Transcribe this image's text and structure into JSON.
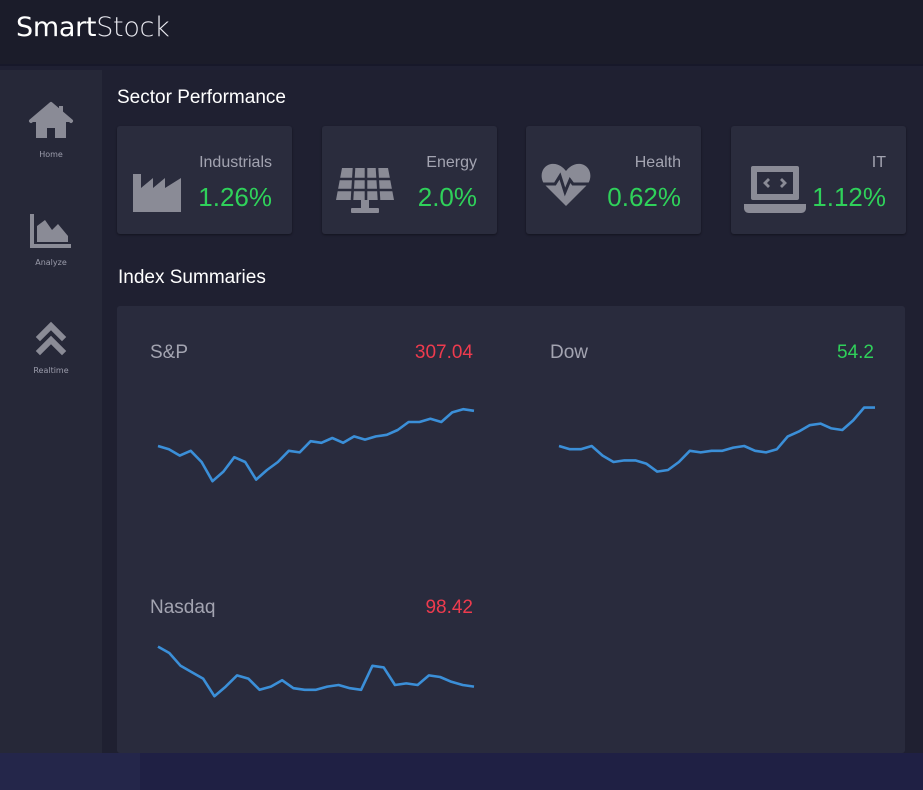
{
  "app": {
    "brand_strong": "Smart",
    "brand_light": "Stock"
  },
  "sidebar": {
    "items": [
      {
        "label": "Home",
        "icon": "home-icon"
      },
      {
        "label": "Analyze",
        "icon": "area-chart-icon"
      },
      {
        "label": "Realtime",
        "icon": "double-chevron-up-icon"
      }
    ]
  },
  "sectors": {
    "title": "Sector Performance",
    "items": [
      {
        "name": "Industrials",
        "value": "1.26%",
        "icon": "factory-icon"
      },
      {
        "name": "Energy",
        "value": "2.0%",
        "icon": "solar-panel-icon"
      },
      {
        "name": "Health",
        "value": "0.62%",
        "icon": "heartbeat-icon"
      },
      {
        "name": "IT",
        "value": "1.12%",
        "icon": "laptop-code-icon"
      }
    ]
  },
  "indexes": {
    "title": "Index Summaries",
    "items": [
      {
        "name": "S&P",
        "value": "307.04",
        "trend": "negative"
      },
      {
        "name": "Dow",
        "value": "54.2",
        "trend": "positive"
      },
      {
        "name": "Nasdaq",
        "value": "98.42",
        "trend": "negative"
      }
    ]
  },
  "colors": {
    "positive": "#2fd15a",
    "negative": "#ee3b4e",
    "line": "#3b8fd8",
    "icon": "#8a8b96"
  },
  "chart_data": [
    {
      "type": "line",
      "name": "S&P",
      "values": [
        50,
        48,
        44,
        47,
        40,
        28,
        34,
        43,
        40,
        29,
        35,
        40,
        47,
        46,
        53,
        52,
        55,
        52,
        56,
        54,
        56,
        57,
        60,
        65,
        65,
        67,
        65,
        71,
        73,
        72
      ]
    },
    {
      "type": "line",
      "name": "Dow",
      "values": [
        50,
        48,
        48,
        50,
        44,
        40,
        41,
        41,
        39,
        34,
        35,
        40,
        47,
        46,
        47,
        47,
        49,
        50,
        47,
        46,
        48,
        56,
        59,
        63,
        64,
        61,
        60,
        66,
        74,
        74
      ]
    },
    {
      "type": "line",
      "name": "Nasdaq",
      "values": [
        84,
        80,
        72,
        68,
        64,
        53,
        59,
        66,
        64,
        57,
        59,
        63,
        58,
        57,
        57,
        59,
        60,
        58,
        57,
        72,
        71,
        60,
        61,
        60,
        66,
        65,
        62,
        60,
        59
      ]
    }
  ]
}
